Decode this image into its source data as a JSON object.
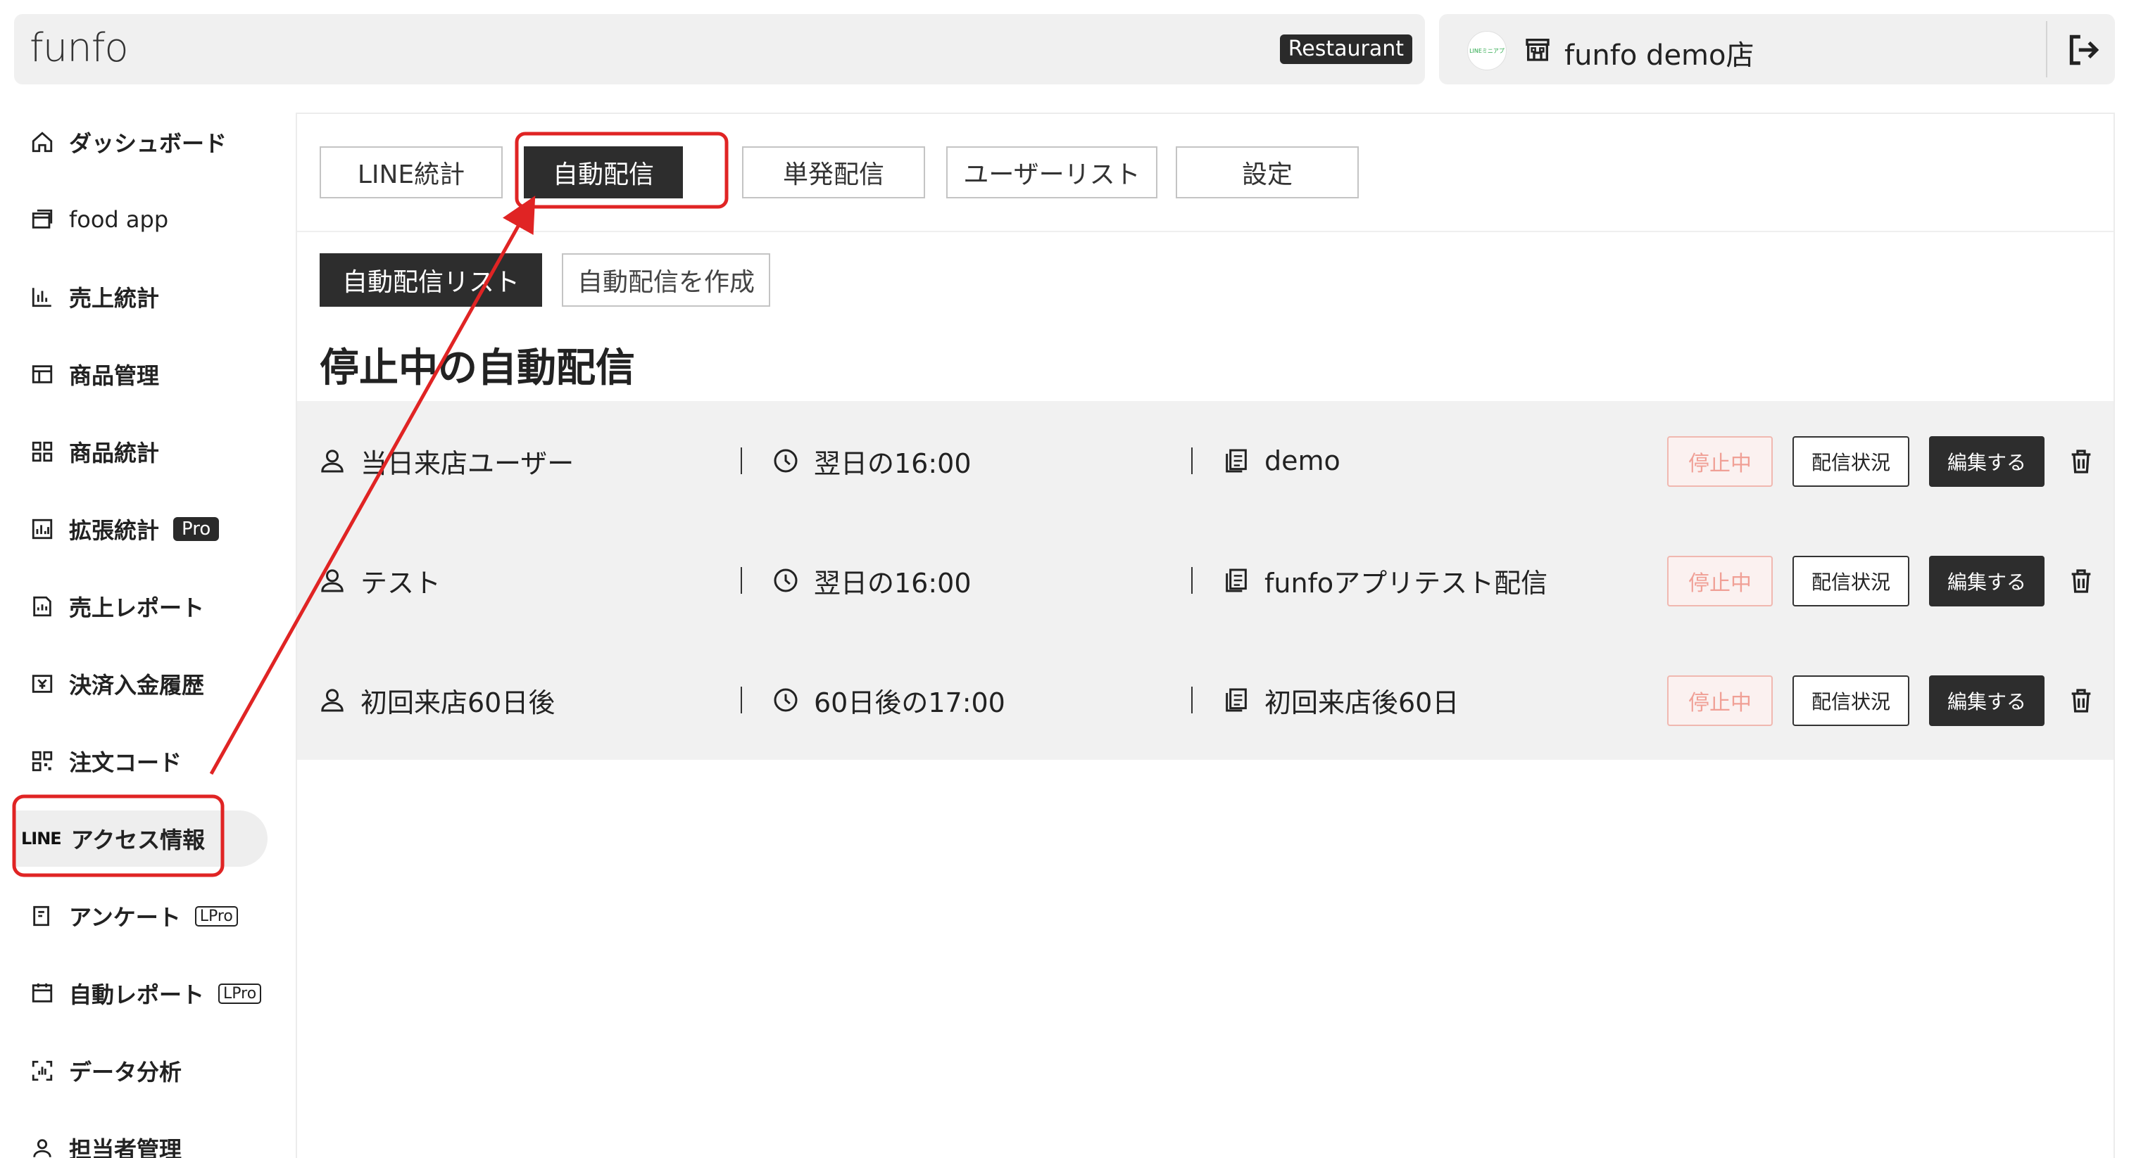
{
  "header": {
    "logo": "funfo",
    "category_badge": "Restaurant",
    "store_avatar_text": "LINEミニアプリ",
    "store_name": "funfo demo店"
  },
  "sidebar": {
    "items": [
      {
        "label": "ダッシュボード",
        "icon": "home-icon"
      },
      {
        "label": "food app",
        "icon": "app-window-icon"
      },
      {
        "label": "売上統計",
        "icon": "bar-chart-icon"
      },
      {
        "label": "商品管理",
        "icon": "product-table-icon"
      },
      {
        "label": "商品統計",
        "icon": "grid-icon"
      },
      {
        "label": "拡張統計",
        "icon": "chart-box-icon",
        "badge": "Pro"
      },
      {
        "label": "売上レポート",
        "icon": "report-icon"
      },
      {
        "label": "決済入金履歴",
        "icon": "payment-history-icon"
      },
      {
        "label": "注文コード",
        "icon": "qr-code-icon"
      },
      {
        "label": "アクセス情報",
        "icon": "line-icon",
        "prefix": "LINE",
        "active": true
      },
      {
        "label": "アンケート",
        "icon": "survey-icon",
        "badge": "LPro"
      },
      {
        "label": "自動レポート",
        "icon": "auto-report-icon",
        "badge": "LPro"
      },
      {
        "label": "データ分析",
        "icon": "data-analysis-icon"
      },
      {
        "label": "担当者管理",
        "icon": "staff-icon"
      }
    ]
  },
  "main": {
    "tabs": [
      "LINE統計",
      "自動配信",
      "単発配信",
      "ユーザーリスト",
      "設定"
    ],
    "active_tab": "自動配信",
    "subtabs": [
      "自動配信リスト",
      "自動配信を作成"
    ],
    "section_title": "停止中の自動配信",
    "rows": [
      {
        "audience": "当日来店ユーザー",
        "schedule": "翌日の16:00",
        "message": "demo",
        "status": "停止中",
        "status_button": "配信状況",
        "edit_button": "編集する"
      },
      {
        "audience": "テスト",
        "schedule": "翌日の16:00",
        "message": "funfoアプリテスト配信",
        "status": "停止中",
        "status_button": "配信状況",
        "edit_button": "編集する"
      },
      {
        "audience": "初回来店60日後",
        "schedule": "60日後の17:00",
        "message": "初回来店後60日",
        "status": "停止中",
        "status_button": "配信状況",
        "edit_button": "編集する"
      }
    ]
  },
  "colors": {
    "highlight": "#e02424",
    "dark_button": "#2d2d2d",
    "stopped_text": "#f0a096"
  }
}
